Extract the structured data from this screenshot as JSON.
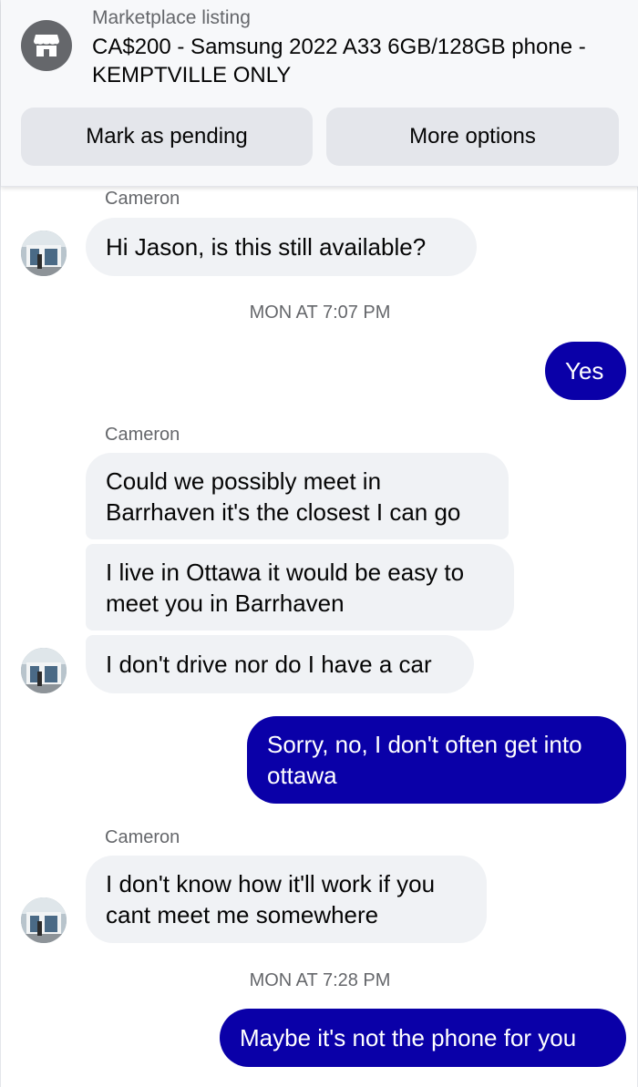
{
  "listing": {
    "label": "Marketplace listing",
    "title": "CA$200 - Samsung 2022 A33 6GB/128GB phone - KEMPTVILLE ONLY"
  },
  "actions": {
    "mark_pending": "Mark as pending",
    "more_options": "More options"
  },
  "conversation": {
    "sender_name": "Cameron",
    "messages": [
      {
        "from": "Cameron",
        "text": "Hi Jason, is this still available?"
      },
      {
        "from": "me",
        "text": "Yes"
      },
      {
        "from": "Cameron",
        "text": "Could we possibly meet in Barrhaven it's the closest I can go"
      },
      {
        "from": "Cameron",
        "text": "I live in Ottawa it would be easy to meet you in Barrhaven"
      },
      {
        "from": "Cameron",
        "text": "I don't drive nor do I have a car"
      },
      {
        "from": "me",
        "text": "Sorry, no, I don't often get into ottawa"
      },
      {
        "from": "Cameron",
        "text": "I don't know how it'll work if you cant meet me somewhere"
      },
      {
        "from": "me",
        "text": "Maybe it's not the phone for you"
      }
    ],
    "timestamps": [
      "MON AT 7:07 PM",
      "MON AT 7:28 PM"
    ]
  },
  "colors": {
    "outgoing_bubble": "#0a00a8",
    "incoming_bubble": "#f0f2f5",
    "secondary_text": "#65676b"
  },
  "icons": {
    "listing": "shop-icon",
    "avatar": "user-avatar-photo"
  }
}
